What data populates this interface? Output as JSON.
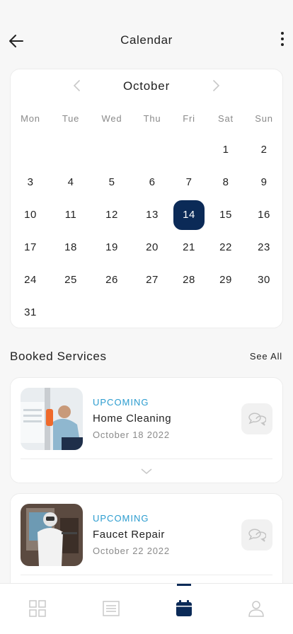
{
  "header": {
    "title": "Calendar"
  },
  "calendar": {
    "month": "October",
    "weekdays": [
      "Mon",
      "Tue",
      "Wed",
      "Thu",
      "Fri",
      "Sat",
      "Sun"
    ],
    "first_weekday_index": 5,
    "days_in_month": 31,
    "selected_day": 14
  },
  "booked": {
    "title": "Booked Services",
    "see_all": "See All",
    "items": [
      {
        "status": "UPCOMING",
        "name": "Home Cleaning",
        "date": "October 18 2022"
      },
      {
        "status": "UPCOMING",
        "name": "Faucet Repair",
        "date": "October 22 2022"
      }
    ]
  },
  "colors": {
    "accent": "#0b2a57",
    "status": "#2b9ccf"
  },
  "nav": {
    "items": [
      {
        "icon": "grid-icon"
      },
      {
        "icon": "list-icon"
      },
      {
        "icon": "calendar-icon",
        "active": true
      },
      {
        "icon": "profile-icon"
      }
    ]
  }
}
